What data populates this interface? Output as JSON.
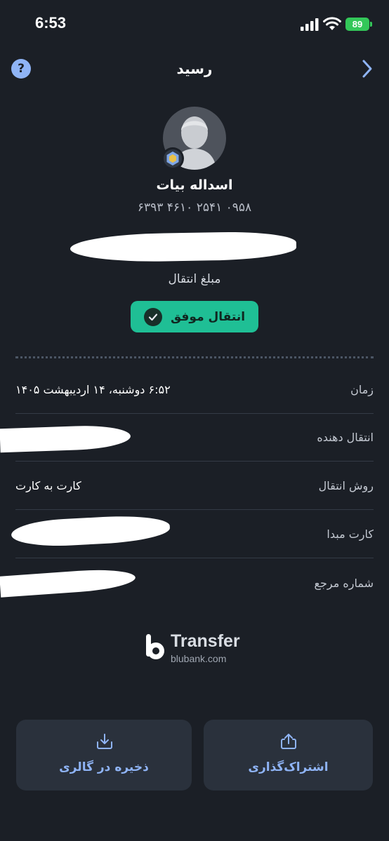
{
  "status_bar": {
    "time": "6:53",
    "battery": "89"
  },
  "header": {
    "title": "رسید",
    "help_icon": "question-circle-icon",
    "back_icon": "chevron-right-icon"
  },
  "recipient": {
    "name": "اسداله بیات",
    "card_number": "۶۳۹۳ ۴۶۱۰ ۲۵۴۱ ۰۹۵۸"
  },
  "amount_label": "مبلغ انتقال",
  "status": {
    "label": "انتقال موفق",
    "color": "#1fbf95"
  },
  "details": [
    {
      "label": "زمان",
      "value": "۶:۵۲ دوشنبه، ۱۴ اردیبهشت ۱۴۰۵"
    },
    {
      "label": "انتقال دهنده",
      "value": ""
    },
    {
      "label": "روش انتقال",
      "value": "کارت به کارت"
    },
    {
      "label": "کارت مبدا",
      "value": ""
    },
    {
      "label": "شماره مرجع",
      "value": ""
    }
  ],
  "logo": {
    "name": "Transfer",
    "domain": "blubank.com"
  },
  "actions": {
    "share_label": "اشتراک‌گذاری",
    "save_label": "ذخیره در گالری"
  },
  "colors": {
    "background": "#1b1f26",
    "accent": "#8fb4f6",
    "success": "#1fbf95"
  }
}
